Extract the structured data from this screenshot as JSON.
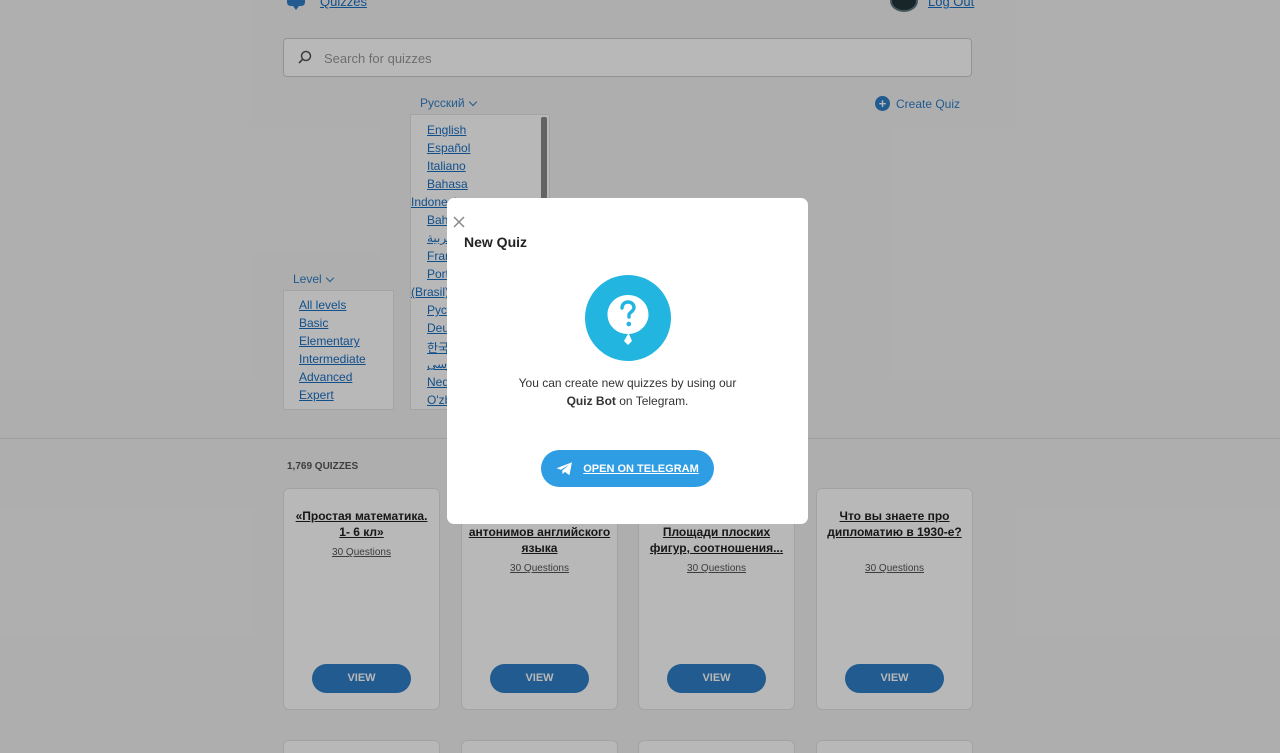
{
  "header": {
    "logo_link": "Quizzes",
    "logout_link": "Log Out"
  },
  "search": {
    "placeholder": "Search for quizzes"
  },
  "filters": {
    "language_label": "Русский",
    "languages": [
      "English",
      "Español",
      "Italiano",
      "Bahasa",
      "Indonesia",
      "Bah",
      "عربية",
      "Fran",
      "Port",
      "(Brasil)",
      "Рус",
      "Deu",
      "한국",
      "فارسی",
      "Ned",
      "O'zb"
    ],
    "level_label": "Level",
    "levels": [
      "All levels",
      "Basic",
      "Elementary",
      "Intermediate",
      "Advanced",
      "Expert"
    ]
  },
  "create_quiz": "Create Quiz",
  "quiz_count": "1,769 QUIZZES",
  "cards": [
    {
      "title": "«Простая математика. 1- 6 кл»",
      "questions": "30 Questions",
      "button": "VIEW"
    },
    {
      "title": "антонимов английского языка",
      "questions": "30 Questions",
      "button": "VIEW"
    },
    {
      "title": "Площади плоских фигур, соотношения...",
      "questions": "30 Questions",
      "button": "VIEW"
    },
    {
      "title": "Что вы знаете про дипломатию в 1930-е?",
      "questions": "30 Questions",
      "button": "VIEW"
    }
  ],
  "modal": {
    "title": "New Quiz",
    "text_line1": "You can create new quizzes by using our",
    "bot_name": "Quiz Bot",
    "text_line2_suffix": " on Telegram.",
    "button": "OPEN ON TELEGRAM"
  },
  "colors": {
    "accent": "#2e7fc6",
    "telegram": "#2e9de4",
    "bubble": "#21b5e0"
  }
}
